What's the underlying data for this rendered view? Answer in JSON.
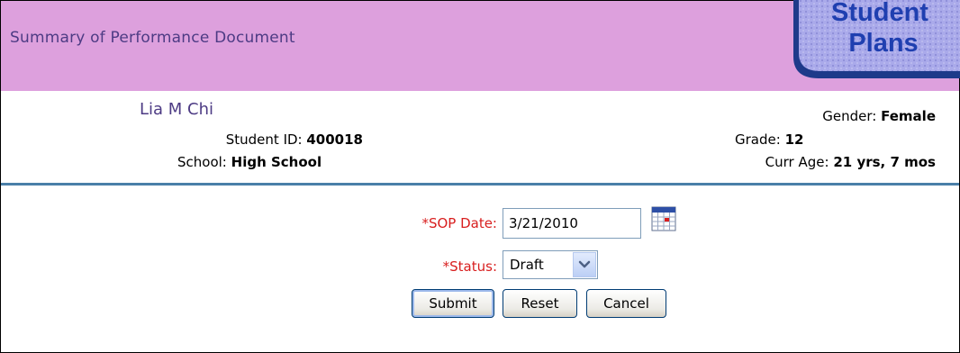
{
  "header": {
    "title": "Summary of Performance Document",
    "logo_line1": "Student",
    "logo_line2": "Plans"
  },
  "student": {
    "name": "Lia M Chi",
    "id_label": "Student ID:",
    "id_value": "400018",
    "school_label": "School:",
    "school_value": "High School",
    "gender_label": "Gender:",
    "gender_value": "Female",
    "grade_label": "Grade:",
    "grade_value": "12",
    "age_label": "Curr Age:",
    "age_value": "21 yrs, 7 mos"
  },
  "form": {
    "sop_date_label": "*SOP Date:",
    "sop_date_value": "3/21/2010",
    "status_label": "*Status:",
    "status_value": "Draft",
    "submit_label": "Submit",
    "reset_label": "Reset",
    "cancel_label": "Cancel"
  },
  "colors": {
    "header_bg": "#dda0dd",
    "title_text": "#4d3b84",
    "required_label": "#d81e1e",
    "divider": "#4a7fa8",
    "logo_bg": "#a9a9e6",
    "logo_border": "#1e3a8a"
  },
  "icons": {
    "calendar": "calendar-icon",
    "dropdown": "chevron-down-icon"
  }
}
